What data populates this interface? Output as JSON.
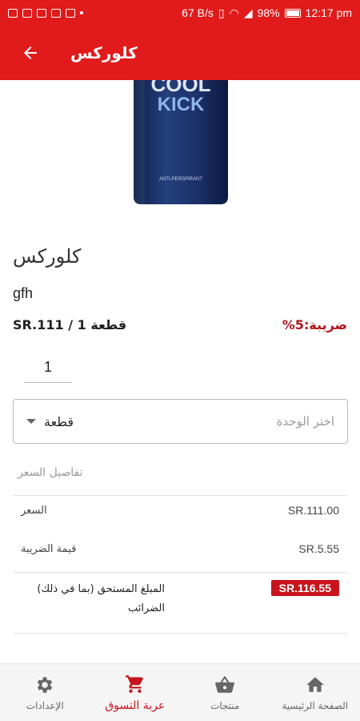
{
  "status_bar": {
    "speed": "67 B/s",
    "signal": "98%",
    "time": "12:17 pm"
  },
  "app_bar": {
    "title": "كلوركس"
  },
  "product": {
    "image_text_line1": "COOL",
    "image_text_line2": "KICK",
    "image_text_line3": "ANTI-PERSPIRANT",
    "name": "كلوركس",
    "description": "gfh",
    "price_line": "قطعة 1 / SR.111",
    "tax_line": "%ضريبة:5",
    "quantity": "1"
  },
  "unit_select": {
    "selected": "قطعة",
    "placeholder": "اختر الوحدة"
  },
  "price_details": {
    "heading": "تفاصيل السعر",
    "rows": [
      {
        "label": "السعر",
        "value": "SR.111.00"
      },
      {
        "label": "قيمة الضريبة",
        "value": "SR.5.55"
      }
    ],
    "total_label": "المبلغ المستحق (بما في ذلك) الضرائب",
    "total_value": "SR.116.55"
  },
  "bottom_nav": {
    "items": [
      {
        "label": "الإعدادات",
        "icon": "gear-icon"
      },
      {
        "label": "عربة التسوق",
        "icon": "cart-icon"
      },
      {
        "label": "منتجات",
        "icon": "basket-icon"
      },
      {
        "label": "الصفحة الرئيسية",
        "icon": "home-icon"
      }
    ],
    "active_index": 1
  },
  "colors": {
    "primary": "#e11b1b",
    "accent_dark": "#c8141c"
  }
}
